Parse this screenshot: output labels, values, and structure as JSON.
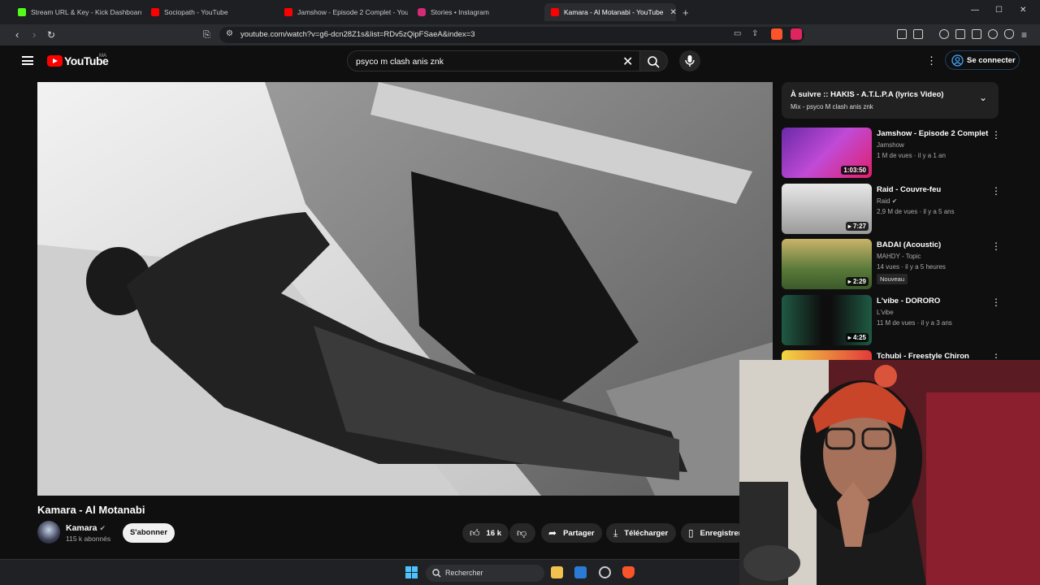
{
  "browser": {
    "tabs": [
      {
        "label": "Stream URL & Key - Kick Dashboard",
        "color": "#53fc18"
      },
      {
        "label": "Sociopath - YouTube",
        "color": "#ff0000"
      },
      {
        "label": "Jamshow - Episode 2 Complet - YouT",
        "color": "#ff0000"
      },
      {
        "label": "Stories • Instagram",
        "color": "#d62976"
      },
      {
        "label": "Kamara - Al Motanabi - YouTube",
        "color": "#ff0000"
      }
    ],
    "new_tab": "+",
    "url": "youtube.com/watch?v=g6-dcn28Z1s&list=RDv5zQipFSaeA&index=3"
  },
  "yt": {
    "logo": "YouTube",
    "region": "MA",
    "search_query": "psyco m clash anis znk",
    "signin": "Se connecter"
  },
  "video": {
    "title": "Kamara - Al Motanabi",
    "channel": "Kamara",
    "subscribers": "115 k abonnés",
    "subscribe": "S'abonner",
    "likes": "16 k",
    "share": "Partager",
    "download": "Télécharger",
    "save": "Enregistrer"
  },
  "sidebar": {
    "up_next_title": "À suivre :: HAKIS - A.T.L.P.A (lyrics Video)",
    "up_next_sub": "Mix - psyco M clash anis znk",
    "items": [
      {
        "title": "Jamshow - Episode 2 Complet",
        "channel": "Jamshow",
        "meta": "1 M de vues · il y a 1 an",
        "duration": "1:03:50"
      },
      {
        "title": "Raid - Couvre-feu",
        "channel": "Raid",
        "meta": "2,9 M de vues · il y a 5 ans",
        "duration": "7:27"
      },
      {
        "title": "BADAI (Acoustic)",
        "channel": "MAHDY - Topic",
        "meta": "14 vues · il y a 5 heures",
        "duration": "2:29",
        "badge": "Nouveau"
      },
      {
        "title": "L'vibe - DORORO",
        "channel": "L'vibe",
        "meta": "11 M de vues · il y a 3 ans",
        "duration": "4:25"
      },
      {
        "title": "Tchubi - Freestyle Chiron"
      }
    ]
  },
  "taskbar": {
    "search": "Rechercher"
  }
}
